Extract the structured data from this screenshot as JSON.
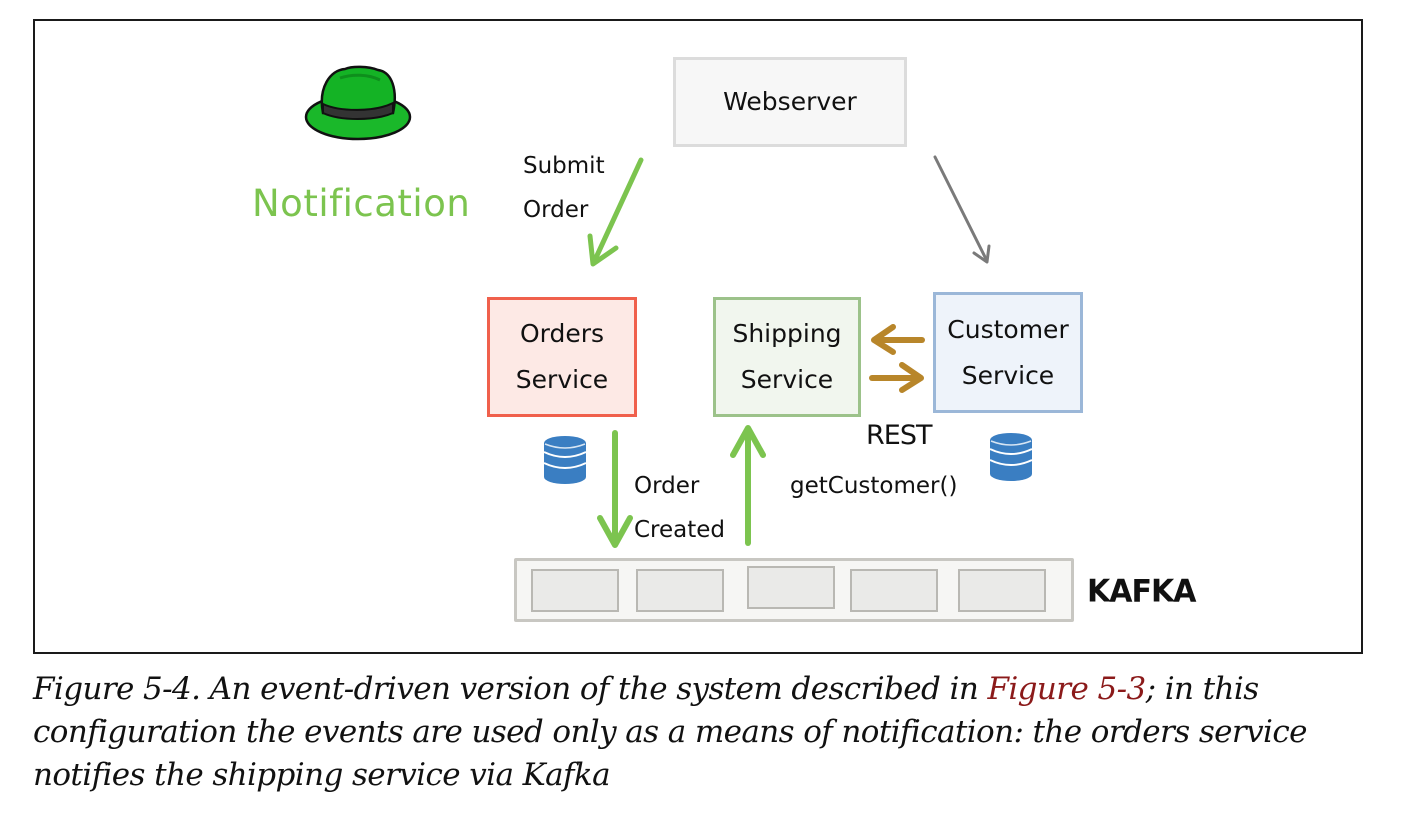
{
  "figure": {
    "pattern_label": "Notification",
    "pattern_icon": "green-fedora-hat-icon",
    "nodes": {
      "webserver": {
        "label": "Webserver",
        "lines": [
          "Webserver"
        ]
      },
      "orders": {
        "label": "Orders Service",
        "lines": [
          "Orders",
          "Service"
        ]
      },
      "shipping": {
        "label": "Shipping Service",
        "lines": [
          "Shipping",
          "Service"
        ]
      },
      "customer": {
        "label": "Customer Service",
        "lines": [
          "Customer",
          "Service"
        ]
      },
      "kafka": {
        "label": "KAFKA",
        "slots": 5
      }
    },
    "edge_labels": {
      "submit_order": [
        "Submit",
        "Order"
      ],
      "order_created": [
        "Order",
        "Created"
      ],
      "rest": "REST",
      "rest_call": "getCustomer()"
    },
    "colors": {
      "event_arrow": "#7cc44f",
      "rest_arrow": "#b8862a",
      "plain_arrow": "#7a7a7a",
      "database": "#3a7ec2",
      "link": "#8b1a1a"
    }
  },
  "caption": {
    "prefix": "Figure 5-4. An event-driven version of the system described in ",
    "link_text": "Figure 5-3",
    "suffix": "; in this configuration the events are used only as a means of notification: the orders service notifies the shipping service via Kafka"
  }
}
